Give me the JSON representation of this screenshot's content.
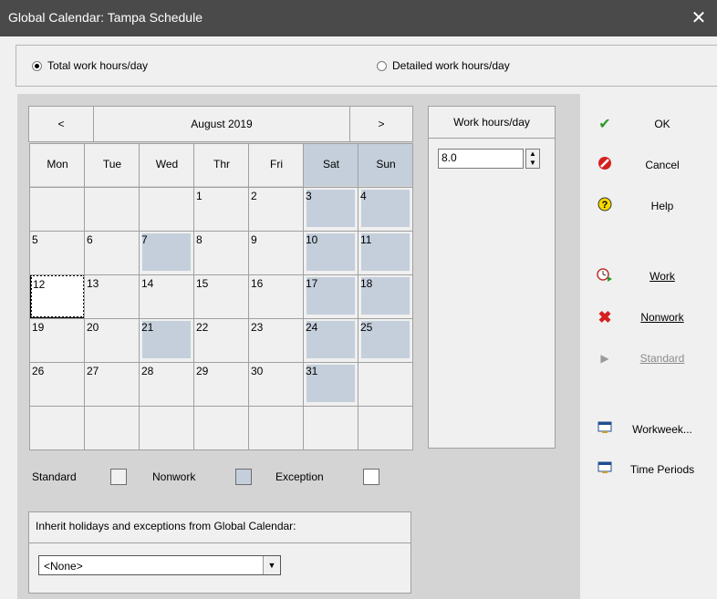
{
  "window": {
    "title": "Global Calendar: Tampa Schedule",
    "close_glyph": "✕"
  },
  "mode": {
    "total_label": "Total work hours/day",
    "detailed_label": "Detailed work hours/day",
    "selected": "total"
  },
  "calendar": {
    "prev_label": "<",
    "next_label": ">",
    "month_label": "August 2019",
    "day_names": [
      "Mon",
      "Tue",
      "Wed",
      "Thr",
      "Fri",
      "Sat",
      "Sun"
    ],
    "weeks": [
      [
        "",
        "",
        "",
        "1",
        "2",
        "3",
        "4"
      ],
      [
        "5",
        "6",
        "7",
        "8",
        "9",
        "10",
        "11"
      ],
      [
        "12",
        "13",
        "14",
        "15",
        "16",
        "17",
        "18"
      ],
      [
        "19",
        "20",
        "21",
        "22",
        "23",
        "24",
        "25"
      ],
      [
        "26",
        "27",
        "28",
        "29",
        "30",
        "31",
        ""
      ],
      [
        "",
        "",
        "",
        "",
        "",
        "",
        ""
      ]
    ],
    "nonwork_days": [
      "3",
      "4",
      "7",
      "10",
      "11",
      "17",
      "18",
      "21",
      "24",
      "25",
      "31"
    ],
    "selected_day": "12"
  },
  "work_hours": {
    "header": "Work hours/day",
    "value": "8.0"
  },
  "legend": {
    "standard": "Standard",
    "nonwork": "Nonwork",
    "exception": "Exception",
    "nonwork_color": "#c4cfdb"
  },
  "inherit": {
    "label": "Inherit holidays and exceptions from Global Calendar:",
    "selected": "<None>"
  },
  "buttons": {
    "ok": "OK",
    "cancel": "Cancel",
    "help": "Help",
    "work": "Work",
    "nonwork": "Nonwork",
    "standard": "Standard",
    "workweek": "Workweek...",
    "time_periods": "Time Periods"
  },
  "colors": {
    "titlebar": "#4a4a4a",
    "panel": "#d4d4d4",
    "nonwork_shade": "#c4cfdb",
    "ok_green": "#2e9a2e",
    "cancel_red": "#d42020",
    "help_yellow": "#f5d800"
  }
}
